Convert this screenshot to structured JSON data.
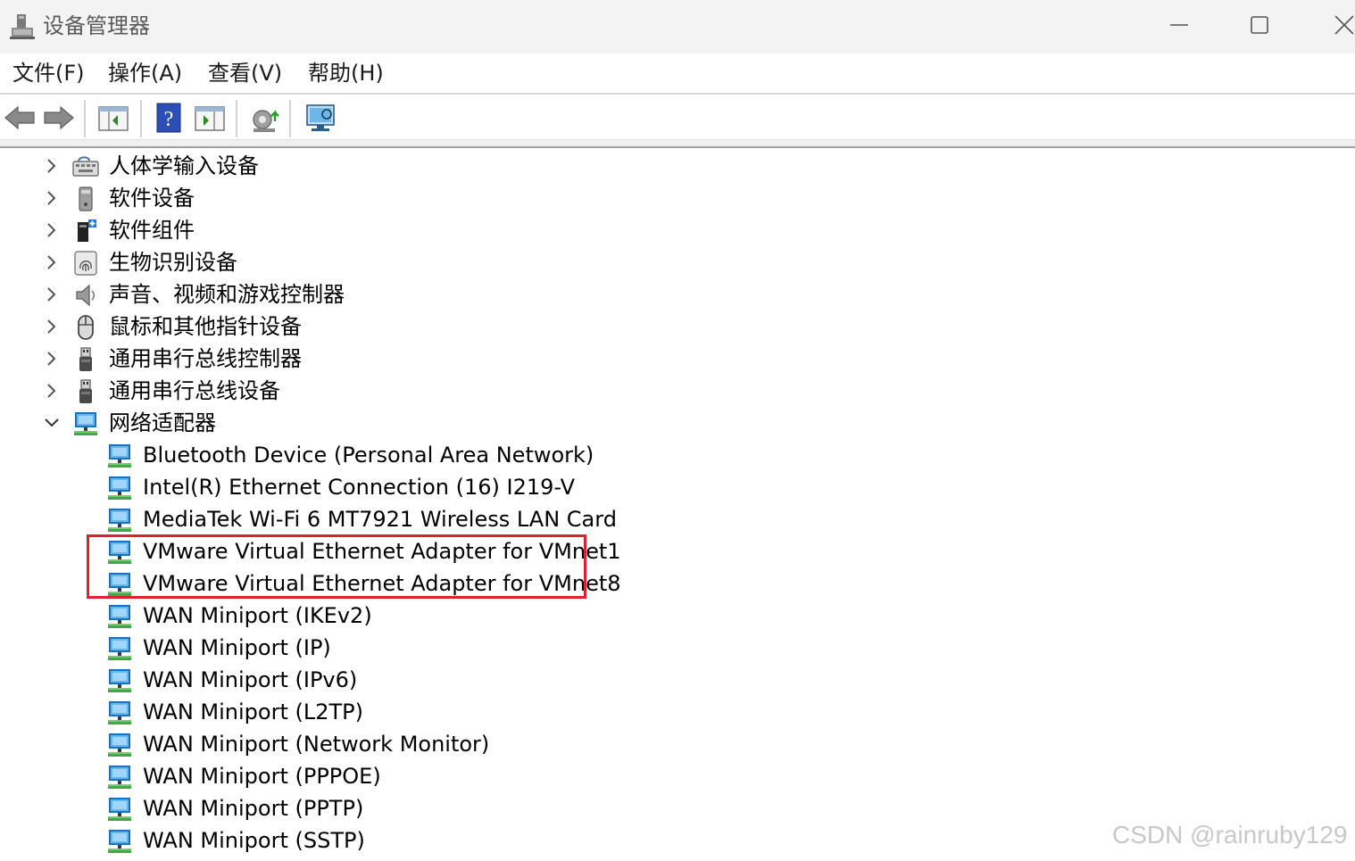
{
  "window": {
    "title": "设备管理器"
  },
  "menu": [
    "文件(F)",
    "操作(A)",
    "查看(V)",
    "帮助(H)"
  ],
  "toolbar": [
    {
      "name": "back-button",
      "icon": "arrow-left-icon"
    },
    {
      "name": "forward-button",
      "icon": "arrow-right-icon"
    },
    {
      "name": "show-hide-console-tree-button",
      "icon": "console-tree-icon"
    },
    {
      "name": "help-button",
      "icon": "help-icon"
    },
    {
      "name": "show-action-pane-button",
      "icon": "action-pane-icon"
    },
    {
      "name": "update-driver-button",
      "icon": "update-driver-icon"
    },
    {
      "name": "scan-hardware-button",
      "icon": "monitor-scan-icon"
    }
  ],
  "categories": [
    {
      "label": "人体学输入设备",
      "icon": "hid-icon",
      "expanded": false
    },
    {
      "label": "软件设备",
      "icon": "software-device-icon",
      "expanded": false
    },
    {
      "label": "软件组件",
      "icon": "software-component-icon",
      "expanded": false
    },
    {
      "label": "生物识别设备",
      "icon": "fingerprint-icon",
      "expanded": false
    },
    {
      "label": "声音、视频和游戏控制器",
      "icon": "speaker-icon",
      "expanded": false
    },
    {
      "label": "鼠标和其他指针设备",
      "icon": "mouse-icon",
      "expanded": false
    },
    {
      "label": "通用串行总线控制器",
      "icon": "usb-icon",
      "expanded": false
    },
    {
      "label": "通用串行总线设备",
      "icon": "usb-icon",
      "expanded": false
    },
    {
      "label": "网络适配器",
      "icon": "network-adapter-icon",
      "expanded": true
    }
  ],
  "network_adapters": [
    "Bluetooth Device (Personal Area Network)",
    "Intel(R) Ethernet Connection (16) I219-V",
    "MediaTek Wi-Fi 6 MT7921 Wireless LAN Card",
    "VMware Virtual Ethernet Adapter for VMnet1",
    "VMware Virtual Ethernet Adapter for VMnet8",
    "WAN Miniport (IKEv2)",
    "WAN Miniport (IP)",
    "WAN Miniport (IPv6)",
    "WAN Miniport (L2TP)",
    "WAN Miniport (Network Monitor)",
    "WAN Miniport (PPPOE)",
    "WAN Miniport (PPTP)",
    "WAN Miniport (SSTP)"
  ],
  "highlight": {
    "color": "#e0202c",
    "covers": [
      "VMware Virtual Ethernet Adapter for VMnet1",
      "VMware Virtual Ethernet Adapter for VMnet8"
    ]
  },
  "watermark": "CSDN @rainruby129"
}
